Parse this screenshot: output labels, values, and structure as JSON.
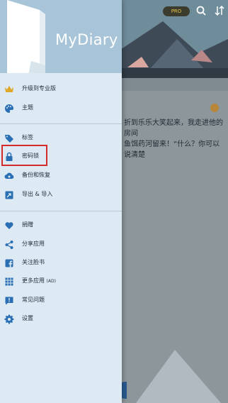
{
  "app": {
    "logo": "MyDiary",
    "pro_badge": "PRO"
  },
  "background": {
    "entry_text": "折到乐乐大笑起来，我走进他的房间\n鱼饵药河留来！“什么？你可以说清楚"
  },
  "menu": {
    "items": [
      {
        "label": "升级到专业版",
        "icon": "crown-icon"
      },
      {
        "label": "主题",
        "icon": "palette-icon"
      },
      {
        "label": "标签",
        "icon": "tag-icon"
      },
      {
        "label": "密码锁",
        "icon": "lock-icon"
      },
      {
        "label": "备份和恢复",
        "icon": "cloud-icon"
      },
      {
        "label": "导出 & 导入",
        "icon": "export-icon"
      },
      {
        "label": "捐赠",
        "icon": "heart-icon"
      },
      {
        "label": "分享应用",
        "icon": "share-icon"
      },
      {
        "label": "关注脸书",
        "icon": "facebook-icon"
      },
      {
        "label": "更多应用",
        "badge": "(AD)",
        "icon": "grid-icon"
      },
      {
        "label": "常见问题",
        "icon": "faq-icon"
      },
      {
        "label": "设置",
        "icon": "gear-icon"
      }
    ]
  },
  "colors": {
    "drawer_bg": "#dde9f3",
    "accent_blue": "#2a6fb3",
    "highlight_red": "#d62b2b",
    "crown_gold": "#e0a82a"
  }
}
